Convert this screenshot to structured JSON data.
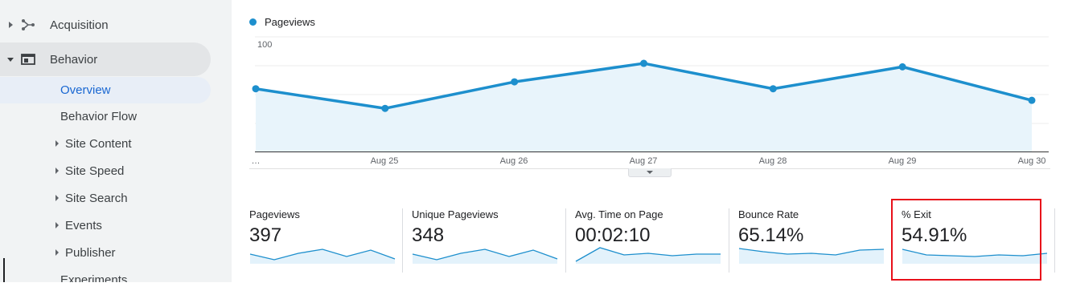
{
  "sidebar": {
    "acquisition": {
      "label": "Acquisition",
      "icon": "acquisition-branch-icon"
    },
    "behavior": {
      "label": "Behavior",
      "icon": "behavior-window-icon"
    },
    "items": [
      {
        "label": "Overview",
        "active": true,
        "expandable": false
      },
      {
        "label": "Behavior Flow",
        "expandable": false
      },
      {
        "label": "Site Content",
        "expandable": true
      },
      {
        "label": "Site Speed",
        "expandable": true
      },
      {
        "label": "Site Search",
        "expandable": true
      },
      {
        "label": "Events",
        "expandable": true
      },
      {
        "label": "Publisher",
        "expandable": true
      },
      {
        "label": "Experiments",
        "expandable": false
      }
    ]
  },
  "chart": {
    "legend_label": "Pageviews",
    "color": "#1d8fcd"
  },
  "chart_data": {
    "type": "area",
    "x": [
      "…",
      "Aug 25",
      "Aug 26",
      "Aug 27",
      "Aug 28",
      "Aug 29",
      "Aug 30"
    ],
    "series": [
      {
        "name": "Pageviews",
        "values": [
          54,
          37,
          60,
          76,
          54,
          73,
          44
        ]
      }
    ],
    "yticks": [
      "100",
      "50"
    ],
    "ylim": [
      0,
      100
    ],
    "grid": true,
    "legend": "top-left"
  },
  "metrics": [
    {
      "label": "Pageviews",
      "value": "397",
      "spark": [
        0.55,
        0.2,
        0.6,
        0.85,
        0.4,
        0.8,
        0.25
      ]
    },
    {
      "label": "Unique Pageviews",
      "value": "348",
      "spark": [
        0.55,
        0.2,
        0.6,
        0.85,
        0.4,
        0.8,
        0.25
      ]
    },
    {
      "label": "Avg. Time on Page",
      "value": "00:02:10",
      "spark": [
        0.1,
        0.95,
        0.5,
        0.6,
        0.45,
        0.55,
        0.55
      ]
    },
    {
      "label": "Bounce Rate",
      "value": "65.14%",
      "spark": [
        0.9,
        0.7,
        0.55,
        0.6,
        0.5,
        0.8,
        0.85
      ]
    },
    {
      "label": "% Exit",
      "value": "54.91%",
      "spark": [
        0.85,
        0.5,
        0.45,
        0.4,
        0.5,
        0.45,
        0.6
      ]
    }
  ],
  "highlight_color": "#e8101a"
}
